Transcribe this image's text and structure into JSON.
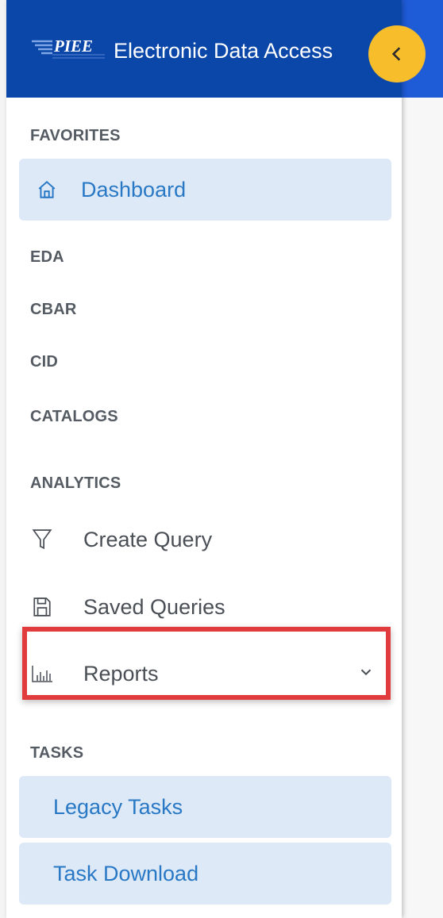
{
  "header": {
    "logo_text": "PIEE",
    "title": "Electronic Data Access"
  },
  "icons": {
    "collapse": "chevron-left-icon",
    "dashboard": "home-icon",
    "create_query": "filter-icon",
    "saved_queries": "save-icon",
    "reports": "bar-chart-icon",
    "reports_expand": "chevron-down-icon"
  },
  "colors": {
    "header_bg": "#0a47a9",
    "collapse_btn": "#f7bd2a",
    "active_item_bg": "#dde9f6",
    "active_item_text": "#2878c6",
    "highlight": "#e23b3e"
  },
  "sidebar": {
    "favorites": {
      "label": "FAVORITES",
      "items": [
        {
          "label": "Dashboard"
        }
      ]
    },
    "sections": [
      {
        "label": "EDA"
      },
      {
        "label": "CBAR"
      },
      {
        "label": "CID"
      },
      {
        "label": "CATALOGS"
      }
    ],
    "analytics": {
      "label": "ANALYTICS",
      "items": [
        {
          "label": "Create Query"
        },
        {
          "label": "Saved Queries"
        },
        {
          "label": "Reports"
        }
      ]
    },
    "tasks": {
      "label": "TASKS",
      "items": [
        {
          "label": "Legacy Tasks"
        },
        {
          "label": "Task Download"
        }
      ]
    }
  }
}
